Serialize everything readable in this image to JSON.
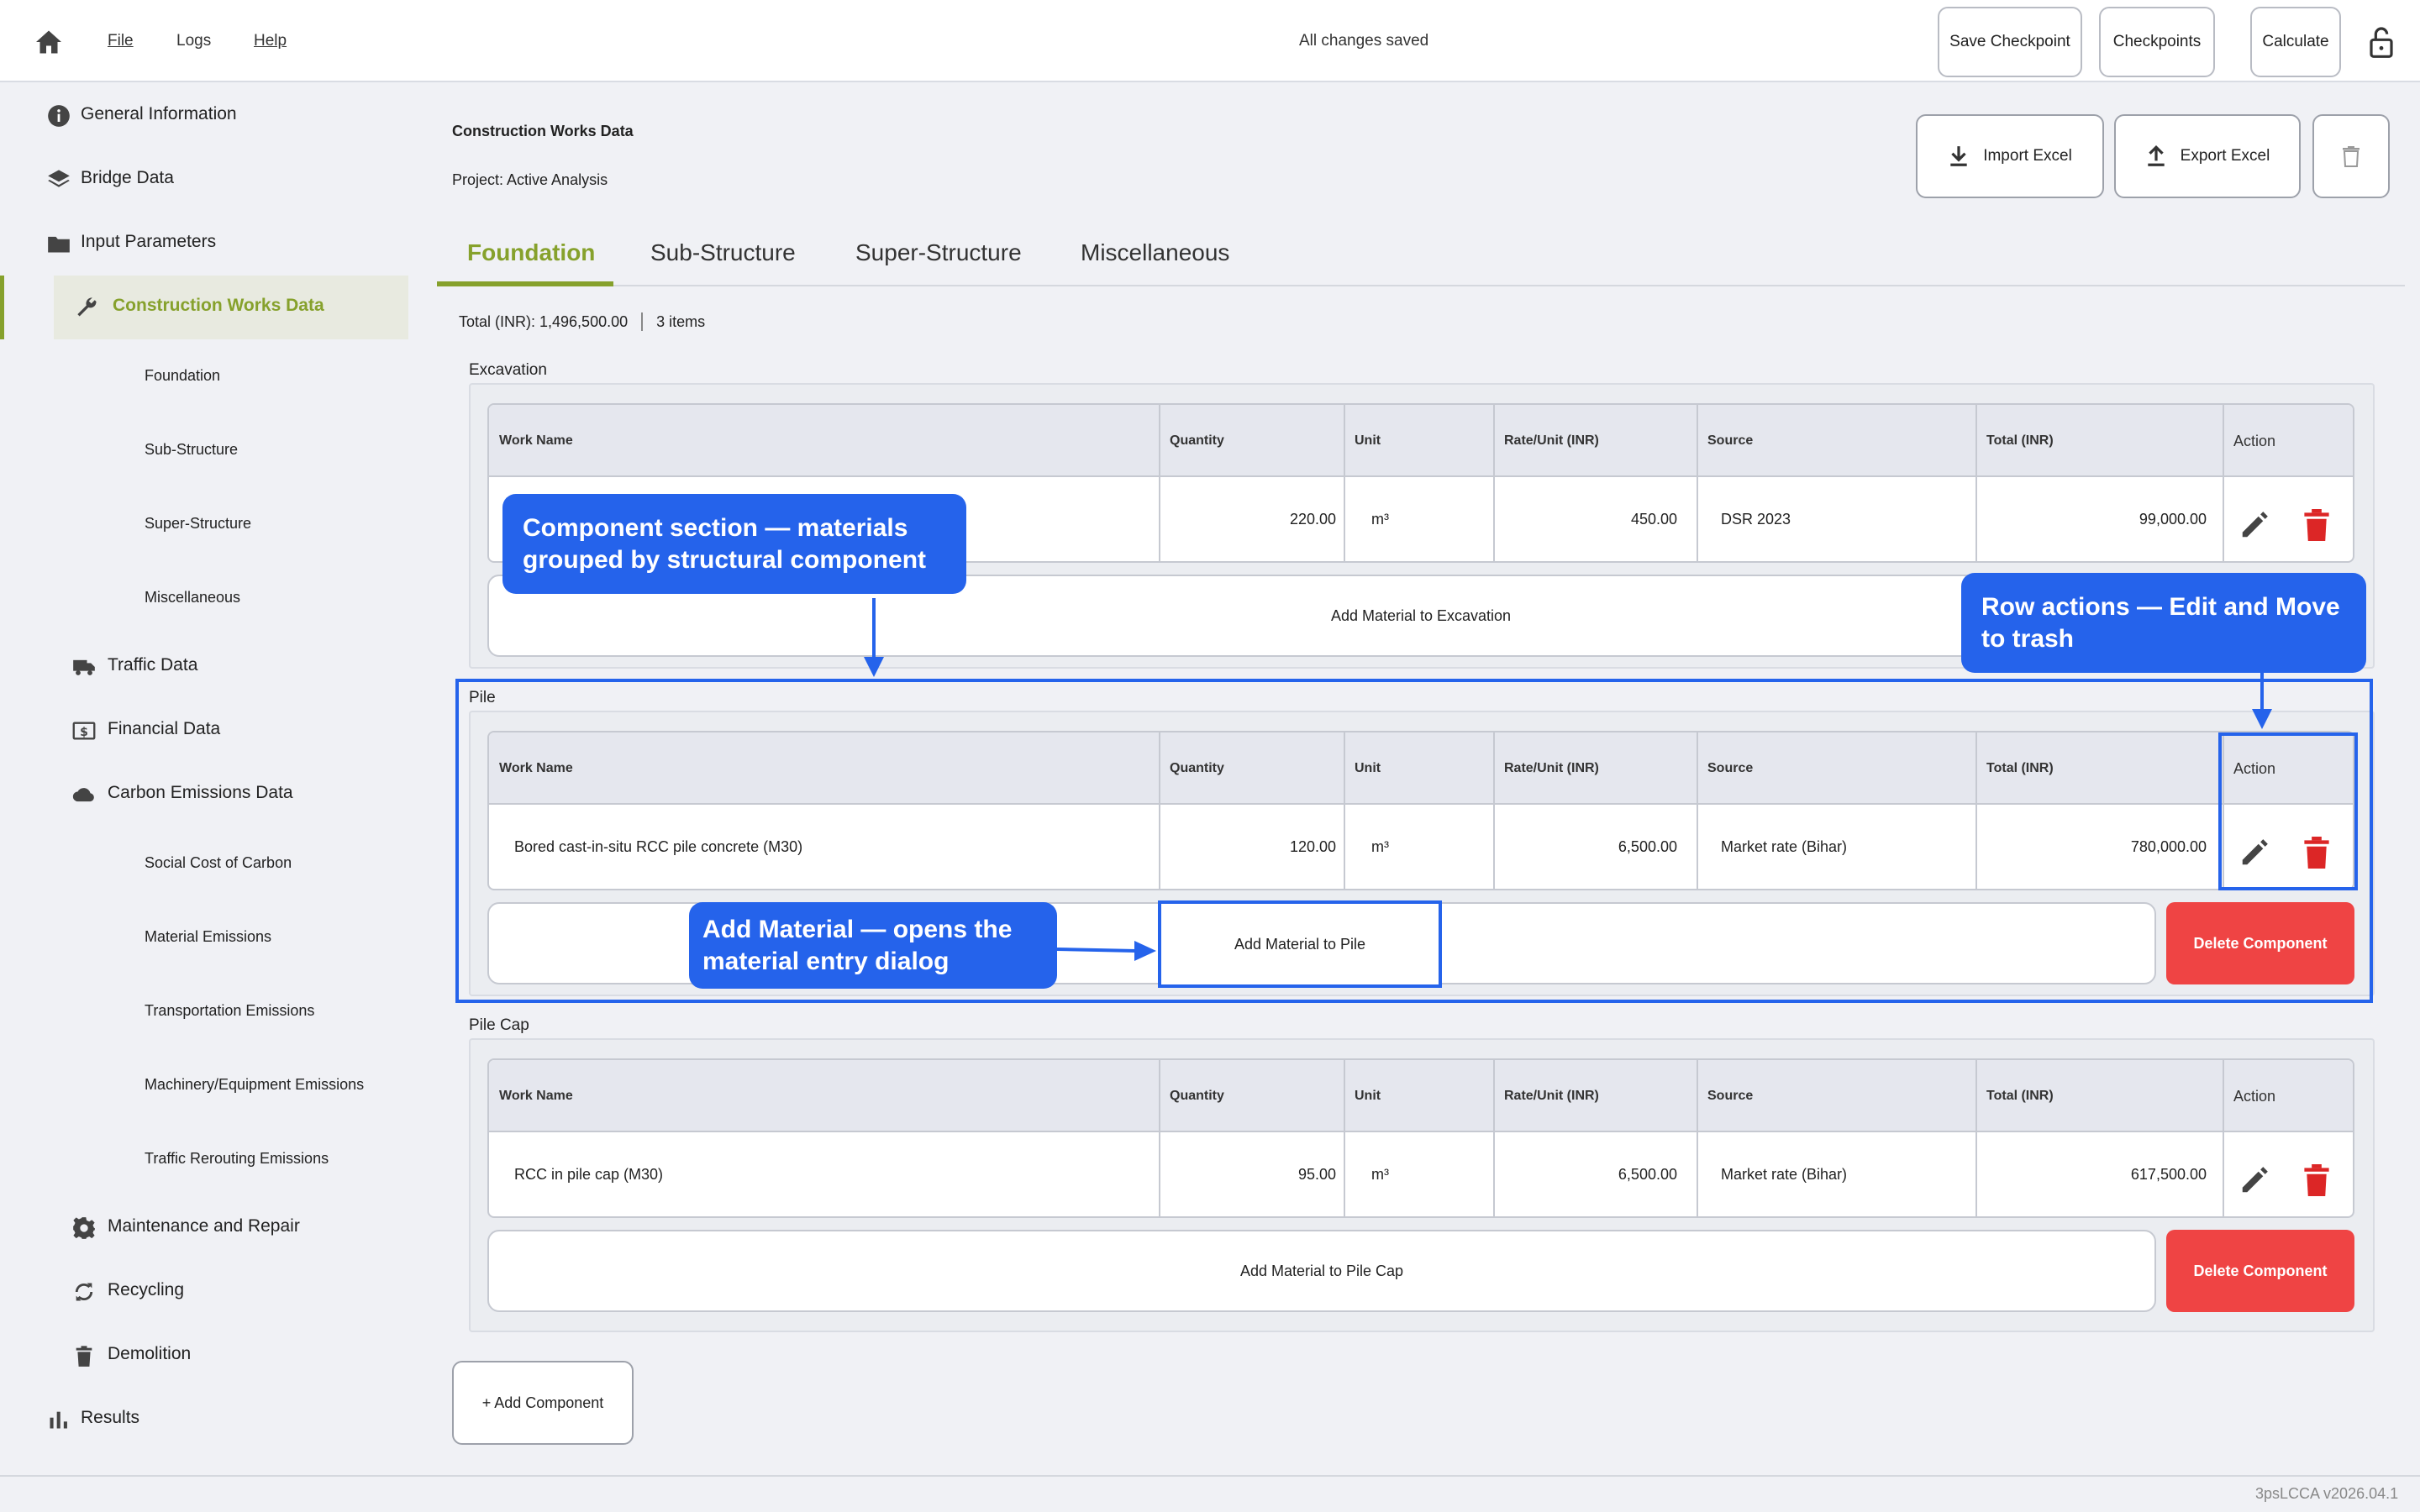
{
  "topbar": {
    "menu": [
      "File",
      "Logs",
      "Help"
    ],
    "status": "All changes saved",
    "buttons": {
      "save_checkpoint": "Save Checkpoint",
      "checkpoints": "Checkpoints",
      "calculate": "Calculate"
    }
  },
  "sidebar": {
    "items": [
      {
        "label": "General Information",
        "icon": "info-icon"
      },
      {
        "label": "Bridge Data",
        "icon": "layers-icon"
      },
      {
        "label": "Input Parameters",
        "icon": "folder-icon"
      },
      {
        "label": "Construction Works Data",
        "icon": "wrench-icon"
      },
      {
        "label": "Traffic Data",
        "icon": "truck-icon"
      },
      {
        "label": "Financial Data",
        "icon": "dollar-icon"
      },
      {
        "label": "Carbon Emissions Data",
        "icon": "cloud-icon"
      },
      {
        "label": "Maintenance and Repair",
        "icon": "gear-icon"
      },
      {
        "label": "Recycling",
        "icon": "recycle-icon"
      },
      {
        "label": "Demolition",
        "icon": "trash-icon"
      },
      {
        "label": "Results",
        "icon": "bar-chart-icon"
      }
    ],
    "construction_sub": [
      "Foundation",
      "Sub-Structure",
      "Super-Structure",
      "Miscellaneous"
    ],
    "carbon_sub": [
      "Social Cost of Carbon",
      "Material Emissions",
      "Transportation Emissions",
      "Machinery/Equipment Emissions",
      "Traffic Rerouting Emissions"
    ]
  },
  "header": {
    "title": "Construction Works Data",
    "project": "Project: Active Analysis",
    "import": "Import Excel",
    "export": "Export Excel"
  },
  "tabs": [
    "Foundation",
    "Sub-Structure",
    "Super-Structure",
    "Miscellaneous"
  ],
  "totals": {
    "total": "Total (INR): 1,496,500.00",
    "count": "3 items"
  },
  "columns": [
    "Work Name",
    "Quantity",
    "Unit",
    "Rate/Unit (INR)",
    "Source",
    "Total (INR)",
    "Action"
  ],
  "sections": [
    {
      "name": "Excavation",
      "row": {
        "work": "",
        "qty": "220.00",
        "unit": "m³",
        "rate": "450.00",
        "source": "DSR 2023",
        "total": "99,000.00"
      },
      "add_label": "Add Material to Excavation"
    },
    {
      "name": "Pile",
      "row": {
        "work": "Bored cast-in-situ RCC pile concrete (M30)",
        "qty": "120.00",
        "unit": "m³",
        "rate": "6,500.00",
        "source": "Market rate (Bihar)",
        "total": "780,000.00"
      },
      "add_label": "Add Material to Pile",
      "delete_label": "Delete Component"
    },
    {
      "name": "Pile Cap",
      "row": {
        "work": "RCC in pile cap (M30)",
        "qty": "95.00",
        "unit": "m³",
        "rate": "6,500.00",
        "source": "Market rate (Bihar)",
        "total": "617,500.00"
      },
      "add_label": "Add Material to Pile Cap",
      "delete_label": "Delete Component"
    }
  ],
  "add_component": "+ Add Component",
  "version": "3psLCCA v2026.04.1",
  "annotations": {
    "component": "Component section — materials grouped by structural component",
    "row_actions": "Row actions — Edit and Move to trash",
    "add_material": "Add Material  —  opens the material entry dialog"
  },
  "colors": {
    "accent": "#86a12c",
    "danger": "#ef4444",
    "annotation": "#2563eb",
    "trash_icon": "#dc2626"
  }
}
